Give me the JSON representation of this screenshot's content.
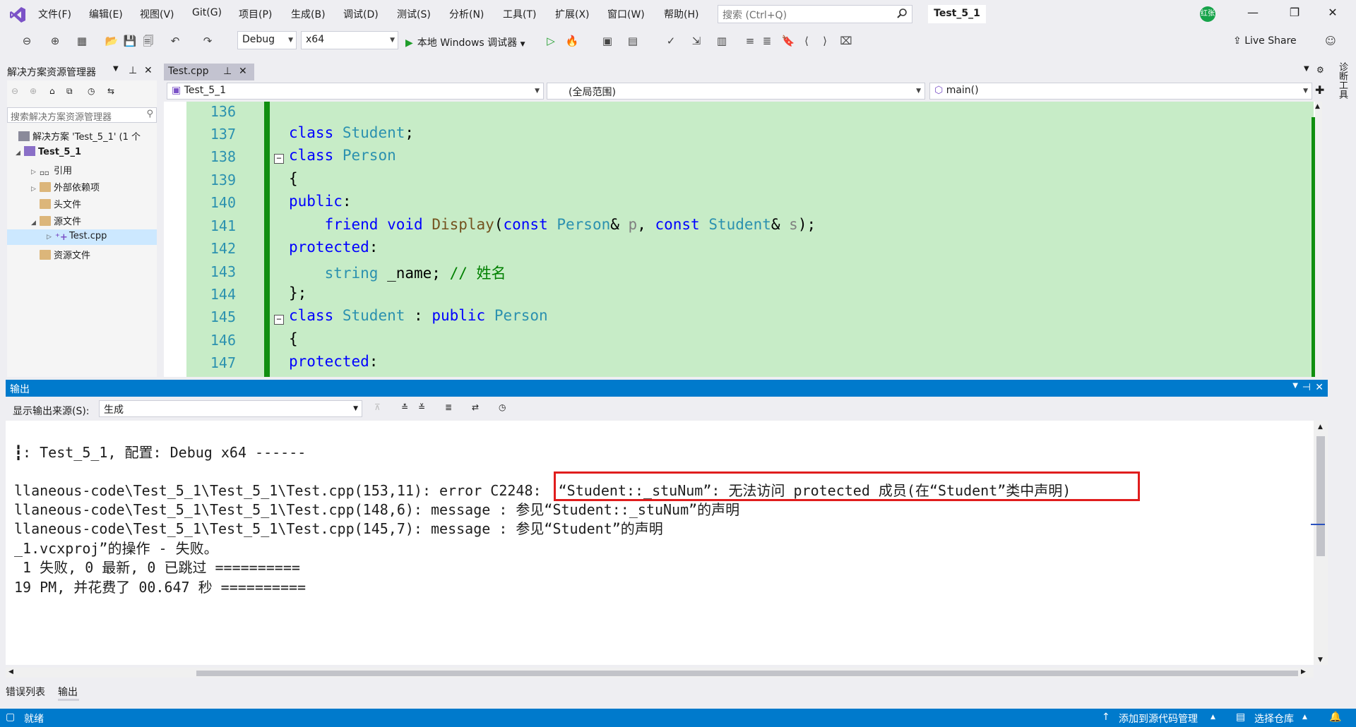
{
  "menu": [
    "文件(F)",
    "编辑(E)",
    "视图(V)",
    "Git(G)",
    "项目(P)",
    "生成(B)",
    "调试(D)",
    "测试(S)",
    "分析(N)",
    "工具(T)",
    "扩展(X)",
    "窗口(W)",
    "帮助(H)"
  ],
  "search_placeholder": "搜索 (Ctrl+Q)",
  "solution_title": "Test_5_1",
  "avatar_text": "红张",
  "toolbar": {
    "config": "Debug",
    "platform": "x64",
    "debugger": "本地 Windows 调试器",
    "live_share": "Live Share"
  },
  "solution_explorer": {
    "title": "解决方案资源管理器",
    "search_placeholder": "搜索解决方案资源管理器",
    "items": [
      {
        "label": "解决方案 'Test_5_1' (1 个",
        "level": 0
      },
      {
        "label": "Test_5_1",
        "level": 1
      },
      {
        "label": "引用",
        "level": 2
      },
      {
        "label": "外部依赖项",
        "level": 2
      },
      {
        "label": "头文件",
        "level": 2
      },
      {
        "label": "源文件",
        "level": 2
      },
      {
        "label": "Test.cpp",
        "level": 3
      },
      {
        "label": "资源文件",
        "level": 2
      }
    ]
  },
  "editor": {
    "tab": "Test.cpp",
    "nav_project": "Test_5_1",
    "nav_scope": "(全局范围)",
    "nav_member": "main()",
    "line_numbers": [
      "136",
      "137",
      "138",
      "139",
      "140",
      "141",
      "142",
      "143",
      "144",
      "145",
      "146",
      "147"
    ],
    "code": {
      "l137_kw": "class",
      "l137_ty": "Student",
      "l137_end": ";",
      "l138_kw": "class",
      "l138_ty": "Person",
      "l139": "{",
      "l140_kw": "public",
      "l140_end": ":",
      "l141_kw1": "friend",
      "l141_kw2": "void",
      "l141_fn": "Display",
      "l141_p1": "(",
      "l141_kw3": "const",
      "l141_ty1": "Person",
      "l141_amp1": "& ",
      "l141_pa1": "p",
      "l141_c": ", ",
      "l141_kw4": "const",
      "l141_ty2": "Student",
      "l141_amp2": "& ",
      "l141_pa2": "s",
      "l141_end": ");",
      "l142_kw": "protected",
      "l142_end": ":",
      "l143_ty": "string",
      "l143_mid": " _name; ",
      "l143_cm": "// 姓名",
      "l144": "};",
      "l145_kw": "class",
      "l145_ty": "Student",
      "l145_c": " : ",
      "l145_kw2": "public",
      "l145_ty2": "Person",
      "l146": "{",
      "l147_kw": "protected",
      "l147_end": ":"
    }
  },
  "output": {
    "title": "输出",
    "source_label": "显示输出来源(S):",
    "source_value": "生成",
    "lines": [
      "┇: Test_5_1, 配置: Debug x64 ------",
      "llaneous-code\\Test_5_1\\Test_5_1\\Test.cpp(153,11): error C2248:  “Student::_stuNum”: 无法访问 protected 成员(在“Student”类中声明)",
      "llaneous-code\\Test_5_1\\Test_5_1\\Test.cpp(148,6): message : 参见“Student::_stuNum”的声明",
      "llaneous-code\\Test_5_1\\Test_5_1\\Test.cpp(145,7): message : 参见“Student”的声明",
      "_1.vcxproj”的操作 - 失败。",
      " 1 失败, 0 最新, 0 已跳过 ==========",
      "19 PM, 并花费了 00.647 秒 =========="
    ]
  },
  "bottom_tabs": [
    "错误列表",
    "输出"
  ],
  "status": {
    "ready": "就绪",
    "add_source": "添加到源代码管理",
    "select_repo": "选择仓库"
  },
  "side_tool": "诊断工具"
}
